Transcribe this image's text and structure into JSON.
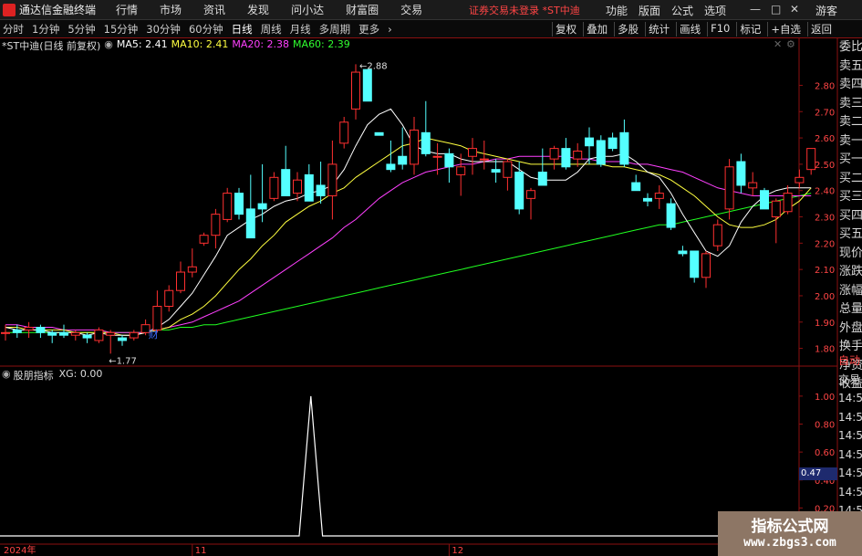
{
  "titlebar": {
    "app_name": "通达信金融终端",
    "menu": [
      "行情",
      "市场",
      "资讯",
      "发现",
      "问小达",
      "财富圈",
      "交易"
    ],
    "notice": "证券交易未登录  *ST中迪",
    "right_menu": [
      "功能",
      "版面",
      "公式",
      "选项"
    ],
    "guest": "游客"
  },
  "toolbar": {
    "periods": [
      "分时",
      "1分钟",
      "5分钟",
      "15分钟",
      "30分钟",
      "60分钟",
      "日线",
      "周线",
      "月线",
      "多周期",
      "更多"
    ],
    "active_period": "日线",
    "right_tools": [
      "复权",
      "叠加",
      "多股",
      "统计",
      "画线",
      "F10",
      "标记",
      "+自选",
      "返回"
    ]
  },
  "main_legend": {
    "stock": "*ST中迪(日线 前复权)",
    "ma5": "MA5: 2.41",
    "ma10": "MA10: 2.41",
    "ma20": "MA20: 2.38",
    "ma60": "MA60: 2.39"
  },
  "indicator_legend": {
    "name": "股朋指标",
    "value": "XG: 0.00"
  },
  "price_axis": [
    "2.80",
    "2.70",
    "2.60",
    "2.50",
    "2.40",
    "2.30",
    "2.20",
    "2.10",
    "2.00",
    "1.90",
    "1.80"
  ],
  "indicator_axis": [
    "1.00",
    "0.80",
    "0.60",
    "0.47",
    "0.40",
    "0.20"
  ],
  "high_label": "2.88",
  "low_label": "1.77",
  "finance_marker": "财",
  "date_axis": [
    "2024年",
    "11",
    "12"
  ],
  "sidebar_labels": [
    "委比",
    "卖五",
    "卖四",
    "卖三",
    "卖二",
    "卖一",
    "买一",
    "买二",
    "买三",
    "买四",
    "买五",
    "现价",
    "涨跌",
    "涨幅",
    "总量",
    "外盘",
    "换手",
    "净资",
    "收益"
  ],
  "sidebar2_labels": [
    "自动",
    "交易",
    "14:54",
    "14:54",
    "14:54",
    "14:54",
    "14:54",
    "14:54",
    "14:55",
    "14:55",
    "14:55"
  ],
  "cursor_value": "0.47",
  "watermark": {
    "line1": "指标公式网",
    "line2": "www.zbgs3.com"
  },
  "colors": {
    "up": "#ff3030",
    "down": "#54ffff",
    "ma5": "#ffffff",
    "ma10": "#ffff40",
    "ma20": "#ff40ff",
    "ma60": "#20ff20"
  },
  "chart_data": {
    "type": "candlestick",
    "ylim": [
      1.75,
      2.93
    ],
    "candles": [
      {
        "o": 1.86,
        "h": 1.89,
        "l": 1.83,
        "c": 1.86
      },
      {
        "o": 1.87,
        "h": 1.89,
        "l": 1.84,
        "c": 1.86
      },
      {
        "o": 1.87,
        "h": 1.9,
        "l": 1.84,
        "c": 1.88
      },
      {
        "o": 1.88,
        "h": 1.89,
        "l": 1.84,
        "c": 1.86
      },
      {
        "o": 1.86,
        "h": 1.87,
        "l": 1.82,
        "c": 1.85
      },
      {
        "o": 1.86,
        "h": 1.89,
        "l": 1.84,
        "c": 1.85
      },
      {
        "o": 1.85,
        "h": 1.87,
        "l": 1.83,
        "c": 1.86
      },
      {
        "o": 1.85,
        "h": 1.86,
        "l": 1.82,
        "c": 1.84
      },
      {
        "o": 1.83,
        "h": 1.88,
        "l": 1.82,
        "c": 1.87
      },
      {
        "o": 1.85,
        "h": 1.87,
        "l": 1.78,
        "c": 1.86
      },
      {
        "o": 1.84,
        "h": 1.85,
        "l": 1.81,
        "c": 1.83
      },
      {
        "o": 1.84,
        "h": 1.87,
        "l": 1.83,
        "c": 1.86
      },
      {
        "o": 1.86,
        "h": 1.91,
        "l": 1.85,
        "c": 1.89
      },
      {
        "o": 1.87,
        "h": 2.02,
        "l": 1.86,
        "c": 1.96
      },
      {
        "o": 1.96,
        "h": 2.04,
        "l": 1.94,
        "c": 2.02
      },
      {
        "o": 2.02,
        "h": 2.13,
        "l": 2.01,
        "c": 2.09
      },
      {
        "o": 2.09,
        "h": 2.18,
        "l": 2.07,
        "c": 2.11
      },
      {
        "o": 2.2,
        "h": 2.24,
        "l": 2.19,
        "c": 2.23
      },
      {
        "o": 2.23,
        "h": 2.33,
        "l": 2.18,
        "c": 2.31
      },
      {
        "o": 2.29,
        "h": 2.41,
        "l": 2.28,
        "c": 2.39
      },
      {
        "o": 2.39,
        "h": 2.41,
        "l": 2.29,
        "c": 2.31
      },
      {
        "o": 2.33,
        "h": 2.46,
        "l": 2.22,
        "c": 2.22
      },
      {
        "o": 2.35,
        "h": 2.5,
        "l": 2.28,
        "c": 2.33
      },
      {
        "o": 2.37,
        "h": 2.47,
        "l": 2.36,
        "c": 2.45
      },
      {
        "o": 2.48,
        "h": 2.57,
        "l": 2.38,
        "c": 2.38
      },
      {
        "o": 2.39,
        "h": 2.47,
        "l": 2.36,
        "c": 2.44
      },
      {
        "o": 2.46,
        "h": 2.5,
        "l": 2.36,
        "c": 2.36
      },
      {
        "o": 2.42,
        "h": 2.51,
        "l": 2.35,
        "c": 2.38
      },
      {
        "o": 2.38,
        "h": 2.59,
        "l": 2.29,
        "c": 2.5
      },
      {
        "o": 2.58,
        "h": 2.68,
        "l": 2.56,
        "c": 2.66
      },
      {
        "o": 2.71,
        "h": 2.88,
        "l": 2.67,
        "c": 2.85
      },
      {
        "o": 2.86,
        "h": 2.85,
        "l": 2.74,
        "c": 2.74
      },
      {
        "o": 2.62,
        "h": 2.61,
        "l": 2.62,
        "c": 2.61
      },
      {
        "o": 2.5,
        "h": 2.59,
        "l": 2.47,
        "c": 2.48
      },
      {
        "o": 2.53,
        "h": 2.64,
        "l": 2.48,
        "c": 2.5
      },
      {
        "o": 2.5,
        "h": 2.68,
        "l": 2.46,
        "c": 2.63
      },
      {
        "o": 2.62,
        "h": 2.74,
        "l": 2.53,
        "c": 2.54
      },
      {
        "o": 2.53,
        "h": 2.58,
        "l": 2.46,
        "c": 2.53
      },
      {
        "o": 2.54,
        "h": 2.56,
        "l": 2.43,
        "c": 2.49
      },
      {
        "o": 2.46,
        "h": 2.54,
        "l": 2.38,
        "c": 2.49
      },
      {
        "o": 2.53,
        "h": 2.6,
        "l": 2.46,
        "c": 2.56
      },
      {
        "o": 2.52,
        "h": 2.59,
        "l": 2.48,
        "c": 2.52
      },
      {
        "o": 2.48,
        "h": 2.52,
        "l": 2.43,
        "c": 2.47
      },
      {
        "o": 2.45,
        "h": 2.52,
        "l": 2.4,
        "c": 2.51
      },
      {
        "o": 2.47,
        "h": 2.51,
        "l": 2.31,
        "c": 2.33
      },
      {
        "o": 2.37,
        "h": 2.41,
        "l": 2.29,
        "c": 2.4
      },
      {
        "o": 2.47,
        "h": 2.56,
        "l": 2.42,
        "c": 2.42
      },
      {
        "o": 2.52,
        "h": 2.57,
        "l": 2.48,
        "c": 2.56
      },
      {
        "o": 2.56,
        "h": 2.6,
        "l": 2.48,
        "c": 2.49
      },
      {
        "o": 2.52,
        "h": 2.58,
        "l": 2.49,
        "c": 2.55
      },
      {
        "o": 2.6,
        "h": 2.64,
        "l": 2.5,
        "c": 2.57
      },
      {
        "o": 2.59,
        "h": 2.61,
        "l": 2.49,
        "c": 2.5
      },
      {
        "o": 2.6,
        "h": 2.62,
        "l": 2.55,
        "c": 2.56
      },
      {
        "o": 2.62,
        "h": 2.67,
        "l": 2.49,
        "c": 2.5
      },
      {
        "o": 2.43,
        "h": 2.46,
        "l": 2.4,
        "c": 2.4
      },
      {
        "o": 2.37,
        "h": 2.39,
        "l": 2.34,
        "c": 2.36
      },
      {
        "o": 2.37,
        "h": 2.42,
        "l": 2.33,
        "c": 2.39
      },
      {
        "o": 2.35,
        "h": 2.37,
        "l": 2.25,
        "c": 2.26
      },
      {
        "o": 2.17,
        "h": 2.19,
        "l": 2.15,
        "c": 2.16
      },
      {
        "o": 2.17,
        "h": 2.17,
        "l": 2.05,
        "c": 2.07
      },
      {
        "o": 2.07,
        "h": 2.17,
        "l": 2.03,
        "c": 2.16
      },
      {
        "o": 2.19,
        "h": 2.29,
        "l": 2.17,
        "c": 2.27
      },
      {
        "o": 2.33,
        "h": 2.52,
        "l": 2.29,
        "c": 2.49
      },
      {
        "o": 2.51,
        "h": 2.54,
        "l": 2.39,
        "c": 2.42
      },
      {
        "o": 2.41,
        "h": 2.47,
        "l": 2.38,
        "c": 2.43
      },
      {
        "o": 2.4,
        "h": 2.41,
        "l": 2.33,
        "c": 2.33
      },
      {
        "o": 2.3,
        "h": 2.37,
        "l": 2.2,
        "c": 2.36
      },
      {
        "o": 2.32,
        "h": 2.42,
        "l": 2.31,
        "c": 2.39
      },
      {
        "o": 2.43,
        "h": 2.48,
        "l": 2.41,
        "c": 2.45
      },
      {
        "o": 2.48,
        "h": 2.56,
        "l": 2.46,
        "c": 2.56
      }
    ],
    "ma5": [
      1.88,
      1.87,
      1.87,
      1.87,
      1.86,
      1.86,
      1.86,
      1.85,
      1.86,
      1.85,
      1.85,
      1.85,
      1.86,
      1.88,
      1.91,
      1.96,
      2.01,
      2.08,
      2.15,
      2.23,
      2.26,
      2.29,
      2.31,
      2.34,
      2.36,
      2.37,
      2.39,
      2.4,
      2.42,
      2.48,
      2.57,
      2.65,
      2.69,
      2.71,
      2.65,
      2.57,
      2.55,
      2.54,
      2.54,
      2.52,
      2.51,
      2.51,
      2.51,
      2.51,
      2.48,
      2.45,
      2.44,
      2.44,
      2.44,
      2.47,
      2.52,
      2.53,
      2.53,
      2.54,
      2.51,
      2.47,
      2.45,
      2.39,
      2.31,
      2.24,
      2.17,
      2.15,
      2.19,
      2.28,
      2.34,
      2.38,
      2.4,
      2.41,
      2.41,
      2.41
    ],
    "ma10": [
      1.88,
      1.88,
      1.87,
      1.87,
      1.87,
      1.87,
      1.86,
      1.86,
      1.86,
      1.86,
      1.85,
      1.85,
      1.86,
      1.87,
      1.88,
      1.91,
      1.93,
      1.96,
      2.0,
      2.05,
      2.1,
      2.14,
      2.19,
      2.23,
      2.28,
      2.31,
      2.34,
      2.36,
      2.39,
      2.41,
      2.45,
      2.48,
      2.51,
      2.54,
      2.57,
      2.58,
      2.6,
      2.59,
      2.58,
      2.57,
      2.55,
      2.54,
      2.53,
      2.52,
      2.51,
      2.5,
      2.5,
      2.5,
      2.5,
      2.5,
      2.5,
      2.5,
      2.49,
      2.49,
      2.48,
      2.47,
      2.46,
      2.44,
      2.41,
      2.38,
      2.34,
      2.3,
      2.27,
      2.26,
      2.26,
      2.27,
      2.29,
      2.33,
      2.36,
      2.41
    ],
    "ma20": [
      1.89,
      1.89,
      1.88,
      1.88,
      1.88,
      1.87,
      1.87,
      1.87,
      1.87,
      1.86,
      1.86,
      1.86,
      1.86,
      1.87,
      1.88,
      1.89,
      1.9,
      1.92,
      1.94,
      1.96,
      1.98,
      2.01,
      2.04,
      2.07,
      2.1,
      2.13,
      2.16,
      2.19,
      2.22,
      2.26,
      2.29,
      2.33,
      2.37,
      2.4,
      2.43,
      2.45,
      2.47,
      2.48,
      2.49,
      2.5,
      2.5,
      2.51,
      2.52,
      2.52,
      2.53,
      2.53,
      2.53,
      2.53,
      2.53,
      2.52,
      2.52,
      2.51,
      2.51,
      2.51,
      2.5,
      2.5,
      2.49,
      2.48,
      2.47,
      2.45,
      2.43,
      2.41,
      2.4,
      2.39,
      2.38,
      2.38,
      2.38,
      2.38,
      2.38,
      2.38
    ],
    "ma60": [
      1.86,
      1.86,
      1.86,
      1.86,
      1.86,
      1.86,
      1.86,
      1.86,
      1.86,
      1.86,
      1.86,
      1.86,
      1.86,
      1.87,
      1.87,
      1.88,
      1.88,
      1.89,
      1.89,
      1.9,
      1.91,
      1.92,
      1.93,
      1.94,
      1.95,
      1.96,
      1.97,
      1.98,
      1.99,
      2.0,
      2.01,
      2.02,
      2.03,
      2.04,
      2.05,
      2.06,
      2.07,
      2.08,
      2.09,
      2.1,
      2.11,
      2.12,
      2.13,
      2.14,
      2.15,
      2.16,
      2.17,
      2.18,
      2.19,
      2.2,
      2.21,
      2.22,
      2.23,
      2.24,
      2.25,
      2.26,
      2.27,
      2.27,
      2.28,
      2.29,
      2.3,
      2.31,
      2.32,
      2.33,
      2.34,
      2.35,
      2.36,
      2.37,
      2.38,
      2.39
    ],
    "xg": [
      0,
      0,
      0,
      0,
      0,
      0,
      0,
      0,
      0,
      0,
      0,
      0,
      0,
      0,
      0,
      0,
      0,
      0,
      0,
      0,
      0,
      0,
      0,
      0,
      0,
      0,
      1,
      0,
      0,
      0,
      0,
      0,
      0,
      0,
      0,
      0,
      0,
      0,
      0,
      0,
      0,
      0,
      0,
      0,
      0,
      0,
      0,
      0,
      0,
      0,
      0,
      0,
      0,
      0,
      0,
      0,
      0,
      0,
      0,
      0,
      0,
      0,
      0,
      0,
      0,
      0,
      0,
      0,
      0,
      0
    ]
  }
}
